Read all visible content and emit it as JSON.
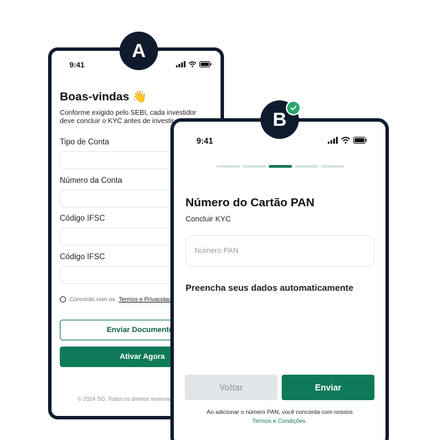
{
  "badges": {
    "a": "A",
    "b": "B"
  },
  "colors": {
    "brand_green": "#0f7a5a",
    "frame_navy": "#0f1b2d",
    "check_green": "#2aa56a",
    "disabled_gray": "#e3e6e8"
  },
  "phone_a": {
    "status_time": "9:41",
    "title": "Boas-vindas 👋",
    "subtitle_line1": "Conforme exigido pelo SEBI, cada investidor",
    "subtitle_line2": "deve concluir o KYC antes de investir.",
    "fields": [
      {
        "label": "Tipo de Conta"
      },
      {
        "label": "Número da Conta"
      },
      {
        "label": "Código IFSC"
      },
      {
        "label": "Código IFSC"
      }
    ],
    "terms_prefix": "Concordo com os",
    "terms_link": "Termos e Privacidade",
    "send_docs_button": "Enviar Documentos",
    "activate_button": "Ativar Agora",
    "footer": "© 2024 SO, Todos os direitos reservados"
  },
  "phone_b": {
    "status_time": "9:41",
    "progress": {
      "total_steps": 5,
      "current_step": 3
    },
    "title": "Número do Cartão PAN",
    "subtitle": "Concluir KYC",
    "pan_input": {
      "placeholder": "Número PAN",
      "value": ""
    },
    "autofill_heading": "Preencha seus dados automaticamente",
    "back_button": "Voltar",
    "send_button": "Enviar",
    "consent_text": "Ao adicionar o número PAN, você concorda com nossos",
    "consent_link": "Termos e Condições."
  }
}
